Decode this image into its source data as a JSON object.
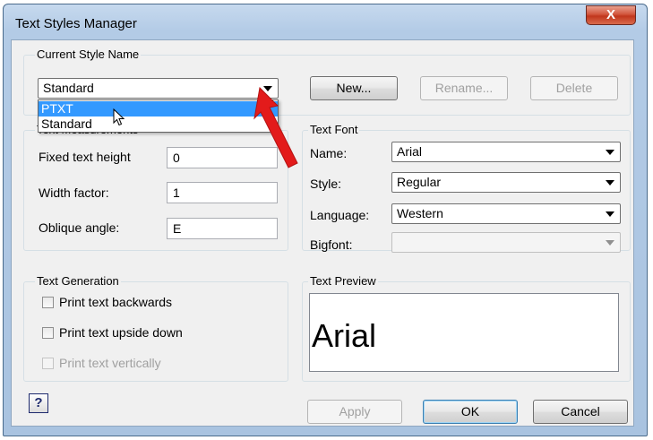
{
  "window": {
    "title": "Text Styles Manager",
    "close_glyph": "X"
  },
  "current_style": {
    "group_label": "Current Style Name",
    "selected_value": "Standard",
    "options": [
      "PTXT",
      "Standard"
    ],
    "highlighted_option": "PTXT",
    "buttons": {
      "new": "New...",
      "rename": "Rename...",
      "delete": "Delete"
    }
  },
  "text_measurements": {
    "group_label": "Text Measurements",
    "fixed_height_label": "Fixed text height",
    "fixed_height_value": "0",
    "width_factor_label": "Width factor:",
    "width_factor_value": "1",
    "oblique_angle_label": "Oblique angle:",
    "oblique_angle_value": "E"
  },
  "text_font": {
    "group_label": "Text Font",
    "name_label": "Name:",
    "name_value": "Arial",
    "style_label": "Style:",
    "style_value": "Regular",
    "language_label": "Language:",
    "language_value": "Western",
    "bigfont_label": "Bigfont:",
    "bigfont_value": ""
  },
  "text_generation": {
    "group_label": "Text Generation",
    "backwards_label": "Print text backwards",
    "upside_down_label": "Print text upside down",
    "vertically_label": "Print text vertically"
  },
  "text_preview": {
    "group_label": "Text Preview",
    "sample": "Arial"
  },
  "footer": {
    "help": "?",
    "apply": "Apply",
    "ok": "OK",
    "cancel": "Cancel"
  },
  "colors": {
    "selection": "#3399ff",
    "annotation_arrow": "#e31b1b",
    "title_gradient": "#b3cbe6"
  },
  "icons": {
    "cursor": "mouse-pointer-icon",
    "annotation": "red-arrow-annotation-icon"
  }
}
